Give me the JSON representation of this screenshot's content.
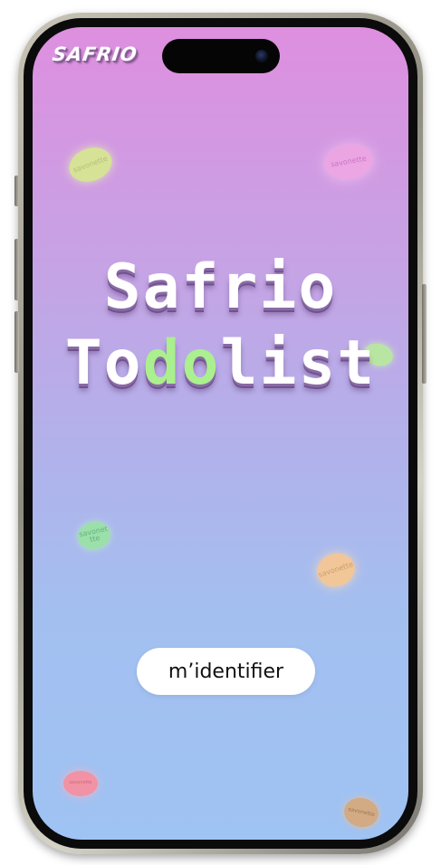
{
  "app": {
    "logo_text": "SAFRIO",
    "title_line1": "Safrio",
    "title_line2_prefix": "To",
    "title_line2_highlight": "do",
    "title_line2_suffix": "list"
  },
  "actions": {
    "login_label": "m’identifier"
  },
  "soaps": [
    {
      "label": "savonette",
      "color": "#d8f08a"
    },
    {
      "label": "savonette",
      "color": "#f0a8e4"
    },
    {
      "label": "",
      "color": "#b9f096"
    },
    {
      "label": "savonet\ntte",
      "color": "#99e6a0"
    },
    {
      "label": "savonette",
      "color": "#ffc98a"
    },
    {
      "label": "savonette",
      "color": "#ff8a98"
    },
    {
      "label": "savonette",
      "color": "#d8a878"
    }
  ],
  "colors": {
    "gradient_top": "#de8fdf",
    "gradient_bottom": "#9fc3f3",
    "highlight": "#aaf08e"
  }
}
